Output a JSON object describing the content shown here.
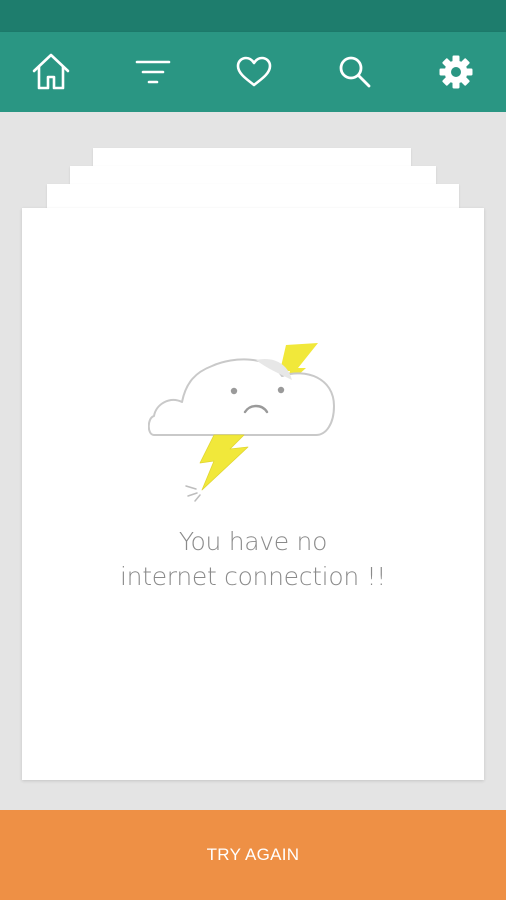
{
  "status_bar": {
    "color": "#1e7d6d"
  },
  "nav_bar": {
    "color": "#2a9683",
    "icon_color": "#ffffff",
    "items": [
      {
        "icon": "home-icon",
        "active": true
      },
      {
        "icon": "filter-icon",
        "active": false
      },
      {
        "icon": "heart-icon",
        "active": false
      },
      {
        "icon": "search-icon",
        "active": false
      },
      {
        "icon": "gear-icon",
        "active": false
      }
    ]
  },
  "error": {
    "illustration": "sad-cloud-lightning-icon",
    "message_line1": "You have no",
    "message_line2": "internet connection !!"
  },
  "action": {
    "label": "TRY AGAIN",
    "color": "#ee9045"
  },
  "colors": {
    "background": "#e4e4e4",
    "card": "#ffffff",
    "text": "#8a8a8a",
    "lightning": "#f1e83a"
  }
}
